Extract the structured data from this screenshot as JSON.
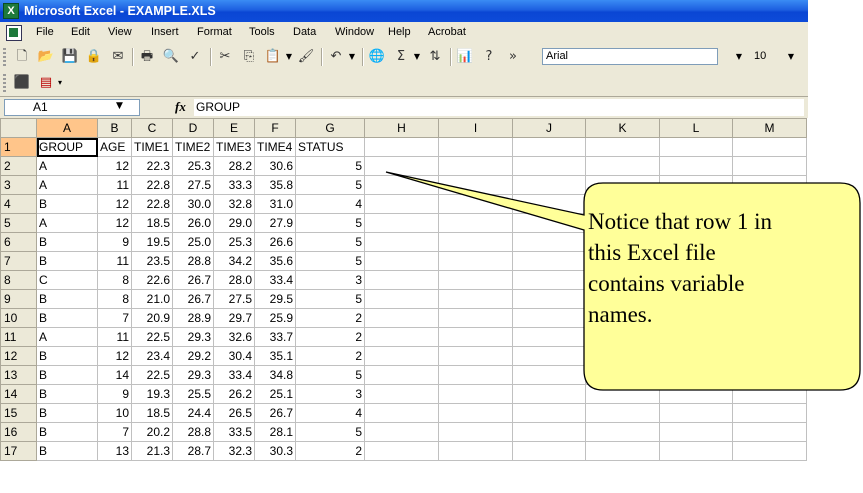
{
  "window": {
    "title": "Microsoft Excel - EXAMPLE.XLS"
  },
  "menu": [
    "File",
    "Edit",
    "View",
    "Insert",
    "Format",
    "Tools",
    "Data",
    "Window",
    "Help",
    "Acrobat"
  ],
  "toolbar": {
    "font_name": "Arial",
    "font_size": "10"
  },
  "formula_bar": {
    "cell_ref": "A1",
    "fx": "fx",
    "content": "GROUP"
  },
  "columns": [
    "A",
    "B",
    "C",
    "D",
    "E",
    "F",
    "G",
    "H",
    "I",
    "J",
    "K",
    "L",
    "M"
  ],
  "rows": [
    [
      "1",
      "GROUP",
      "AGE",
      "TIME1",
      "TIME2",
      "TIME3",
      "TIME4",
      "STATUS"
    ],
    [
      "2",
      "A",
      "12",
      "22.3",
      "25.3",
      "28.2",
      "30.6",
      "5"
    ],
    [
      "3",
      "A",
      "11",
      "22.8",
      "27.5",
      "33.3",
      "35.8",
      "5"
    ],
    [
      "4",
      "B",
      "12",
      "22.8",
      "30.0",
      "32.8",
      "31.0",
      "4"
    ],
    [
      "5",
      "A",
      "12",
      "18.5",
      "26.0",
      "29.0",
      "27.9",
      "5"
    ],
    [
      "6",
      "B",
      "9",
      "19.5",
      "25.0",
      "25.3",
      "26.6",
      "5"
    ],
    [
      "7",
      "B",
      "11",
      "23.5",
      "28.8",
      "34.2",
      "35.6",
      "5"
    ],
    [
      "8",
      "C",
      "8",
      "22.6",
      "26.7",
      "28.0",
      "33.4",
      "3"
    ],
    [
      "9",
      "B",
      "8",
      "21.0",
      "26.7",
      "27.5",
      "29.5",
      "5"
    ],
    [
      "10",
      "B",
      "7",
      "20.9",
      "28.9",
      "29.7",
      "25.9",
      "2"
    ],
    [
      "11",
      "A",
      "11",
      "22.5",
      "29.3",
      "32.6",
      "33.7",
      "2"
    ],
    [
      "12",
      "B",
      "12",
      "23.4",
      "29.2",
      "30.4",
      "35.1",
      "2"
    ],
    [
      "13",
      "B",
      "14",
      "22.5",
      "29.3",
      "33.4",
      "34.8",
      "5"
    ],
    [
      "14",
      "B",
      "9",
      "19.3",
      "25.5",
      "26.2",
      "25.1",
      "3"
    ],
    [
      "15",
      "B",
      "10",
      "18.5",
      "24.4",
      "26.5",
      "26.7",
      "4"
    ],
    [
      "16",
      "B",
      "7",
      "20.2",
      "28.8",
      "33.5",
      "28.1",
      "5"
    ],
    [
      "17",
      "B",
      "13",
      "21.3",
      "28.7",
      "32.3",
      "30.3",
      "2"
    ]
  ],
  "callout": {
    "lines": [
      "Notice that row 1 in",
      "this Excel file",
      "contains variable",
      "names."
    ]
  },
  "colors": {
    "title_bar": "#0a46d4",
    "callout_fill": "#ffff99",
    "selected_header": "#ffc58a"
  }
}
